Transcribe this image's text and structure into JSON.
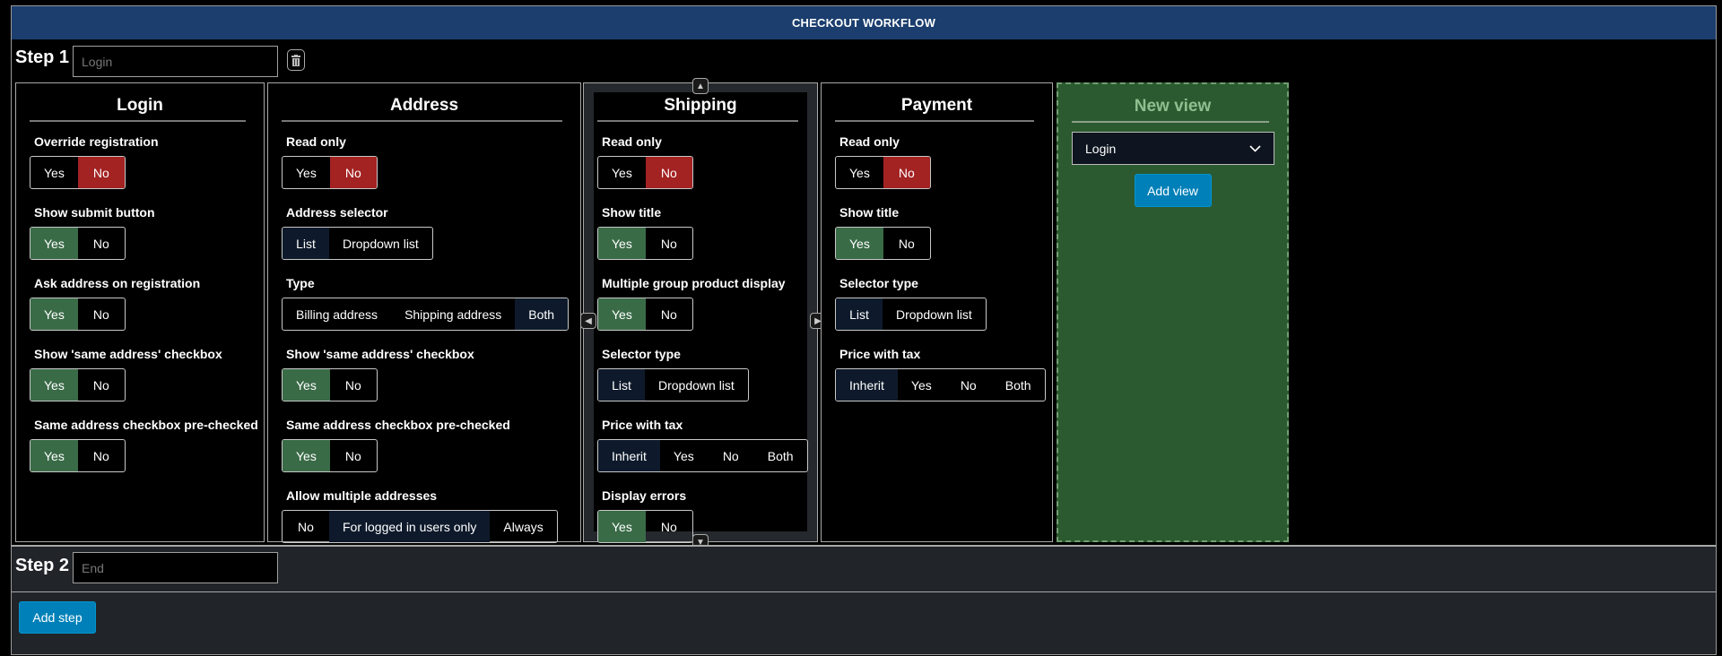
{
  "header": {
    "title": "CHECKOUT WORKFLOW"
  },
  "steps": [
    {
      "label": "Step 1",
      "input_value": "Login"
    },
    {
      "label": "Step 2",
      "input_value": "End"
    }
  ],
  "columns": [
    {
      "title": "Login",
      "settings": [
        {
          "label": "Override registration",
          "options": [
            "Yes",
            "No"
          ],
          "selected": "No"
        },
        {
          "label": "Show submit button",
          "options": [
            "Yes",
            "No"
          ],
          "selected": "Yes"
        },
        {
          "label": "Ask address on registration",
          "options": [
            "Yes",
            "No"
          ],
          "selected": "Yes"
        },
        {
          "label": "Show 'same address' checkbox",
          "options": [
            "Yes",
            "No"
          ],
          "selected": "Yes"
        },
        {
          "label": "Same address checkbox pre-checked",
          "options": [
            "Yes",
            "No"
          ],
          "selected": "Yes"
        }
      ]
    },
    {
      "title": "Address",
      "settings": [
        {
          "label": "Read only",
          "options": [
            "Yes",
            "No"
          ],
          "selected": "No"
        },
        {
          "label": "Address selector",
          "options": [
            "List",
            "Dropdown list"
          ],
          "selected": "List"
        },
        {
          "label": "Type",
          "options": [
            "Billing address",
            "Shipping address",
            "Both"
          ],
          "selected": "Both"
        },
        {
          "label": "Show 'same address' checkbox",
          "options": [
            "Yes",
            "No"
          ],
          "selected": "Yes"
        },
        {
          "label": "Same address checkbox pre-checked",
          "options": [
            "Yes",
            "No"
          ],
          "selected": "Yes"
        },
        {
          "label": "Allow multiple addresses",
          "options": [
            "No",
            "For logged in users only",
            "Always"
          ],
          "selected": "For logged in users only"
        }
      ]
    },
    {
      "title": "Shipping",
      "settings": [
        {
          "label": "Read only",
          "options": [
            "Yes",
            "No"
          ],
          "selected": "No"
        },
        {
          "label": "Show title",
          "options": [
            "Yes",
            "No"
          ],
          "selected": "Yes"
        },
        {
          "label": "Multiple group product display",
          "options": [
            "Yes",
            "No"
          ],
          "selected": "Yes"
        },
        {
          "label": "Selector type",
          "options": [
            "List",
            "Dropdown list"
          ],
          "selected": "List"
        },
        {
          "label": "Price with tax",
          "options": [
            "Inherit",
            "Yes",
            "No",
            "Both"
          ],
          "selected": "Inherit"
        },
        {
          "label": "Display errors",
          "options": [
            "Yes",
            "No"
          ],
          "selected": "Yes"
        }
      ]
    },
    {
      "title": "Payment",
      "settings": [
        {
          "label": "Read only",
          "options": [
            "Yes",
            "No"
          ],
          "selected": "No"
        },
        {
          "label": "Show title",
          "options": [
            "Yes",
            "No"
          ],
          "selected": "Yes"
        },
        {
          "label": "Selector type",
          "options": [
            "List",
            "Dropdown list"
          ],
          "selected": "List"
        },
        {
          "label": "Price with tax",
          "options": [
            "Inherit",
            "Yes",
            "No",
            "Both"
          ],
          "selected": "Inherit"
        }
      ]
    }
  ],
  "new_view": {
    "title": "New view",
    "select_value": "Login",
    "add_label": "Add view"
  },
  "add_step_label": "Add step",
  "colors": {
    "header": "#1b3e6e",
    "yes_selected": "#3a6b47",
    "no_selected": "#a32222",
    "option_selected": "#0e1a2b",
    "accent": "#0080b8"
  }
}
